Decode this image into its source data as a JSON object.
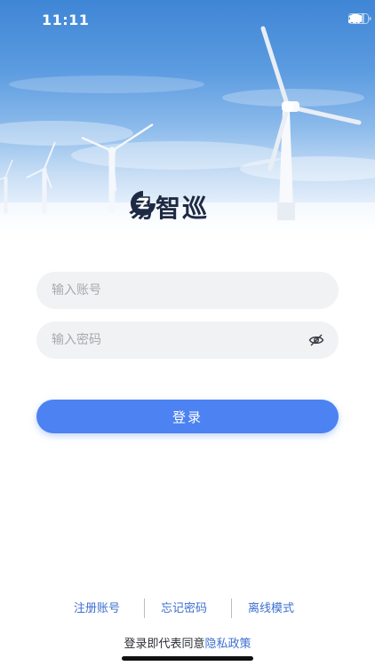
{
  "status_bar": {
    "time": "11:11",
    "icons": [
      "signal-icon",
      "wifi-icon",
      "battery-icon"
    ]
  },
  "brand": {
    "logo_icon": "z-logo-icon",
    "name": "易智巡",
    "color": "#1e2a44"
  },
  "form": {
    "account": {
      "value": "",
      "placeholder": "输入账号"
    },
    "password": {
      "value": "",
      "placeholder": "输入密码",
      "toggle_icon": "eye-hidden-icon"
    },
    "login_label": "登录"
  },
  "links": {
    "register": "注册账号",
    "forgot": "忘记密码",
    "offline": "离线模式"
  },
  "agreement": {
    "prefix": "登录即代表同意",
    "policy": "隐私政策"
  },
  "colors": {
    "accent": "#4c82f2",
    "link": "#3d6fcf",
    "field_bg": "#f1f2f4"
  }
}
